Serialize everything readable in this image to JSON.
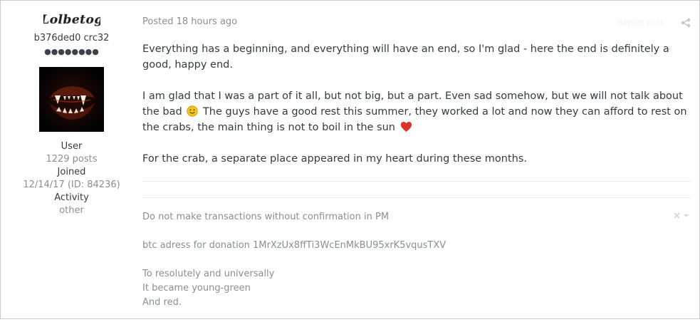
{
  "author": {
    "username": "Lolbetog",
    "user_id_line": "b376ded0 crc32",
    "rank_dots": "●●●●●●●●",
    "group": "User",
    "posts": "1229 posts",
    "joined_label": "Joined",
    "joined_value": "12/14/17 (ID: 84236)",
    "activity_label": "Activity",
    "activity_value": "other"
  },
  "post": {
    "posted_prefix": "Posted ",
    "posted_time": "18 hours ago",
    "report_label": "Report post",
    "paragraph_1": "Everything has a beginning, and everything will have an end, so I'm glad - here the end is definitely a good, happy end.",
    "paragraph_2_part_1": "I am glad that I was a part of it all, but not big, but a part. Even sad somehow, but we will not talk about the bad",
    "paragraph_2_part_2": "The guys have a good rest this summer, they worked a lot and now they can afford to rest on the crabs, the main thing is not to boil in the sun",
    "paragraph_3": "For the crab, a separate place appeared in my heart during these months."
  },
  "signature": {
    "line_1": "Do not make transactions without confirmation in PM",
    "line_2": "btc adress for donation 1MrXzUx8ffTi3WcEnMkBU95xrK5vqusTXV",
    "line_3": "To resolutely and universally",
    "line_4": "It became young-green",
    "line_5": "And red."
  },
  "colors": {
    "text": "#353c41",
    "muted": "#8a8f96",
    "border": "#c9cdd1",
    "heart": "#d9352b",
    "emoji": "#f5c51b"
  },
  "icons": {
    "share": "share-icon",
    "close": "close-icon",
    "smile": "smile-emoji-icon",
    "heart": "heart-icon"
  }
}
